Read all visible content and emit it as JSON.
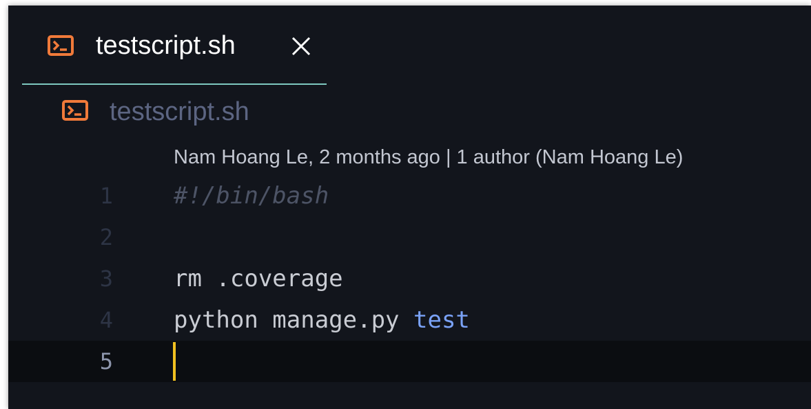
{
  "tab": {
    "title": "testscript.sh",
    "icon": "terminal-file-icon",
    "close_icon": "close-icon",
    "underline_color": "#7ec8bf"
  },
  "breadcrumb": {
    "file": "testscript.sh",
    "icon": "terminal-file-icon"
  },
  "blame": {
    "text": "Nam Hoang Le, 2 months ago | 1 author (Nam Hoang Le)"
  },
  "editor": {
    "current_line": 5,
    "lines": [
      {
        "number": "1",
        "tokens": [
          {
            "text": "#!/bin/bash",
            "kind": "comment"
          }
        ]
      },
      {
        "number": "2",
        "tokens": []
      },
      {
        "number": "3",
        "tokens": [
          {
            "text": "rm .coverage",
            "kind": "plain"
          }
        ]
      },
      {
        "number": "4",
        "tokens": [
          {
            "text": "python manage.py ",
            "kind": "plain"
          },
          {
            "text": "test",
            "kind": "keyword"
          }
        ]
      },
      {
        "number": "5",
        "tokens": []
      }
    ]
  },
  "colors": {
    "background": "#12151c",
    "icon_orange": "#f07a3a",
    "keyword": "#7aa2f7",
    "cursor": "#f0c020"
  }
}
